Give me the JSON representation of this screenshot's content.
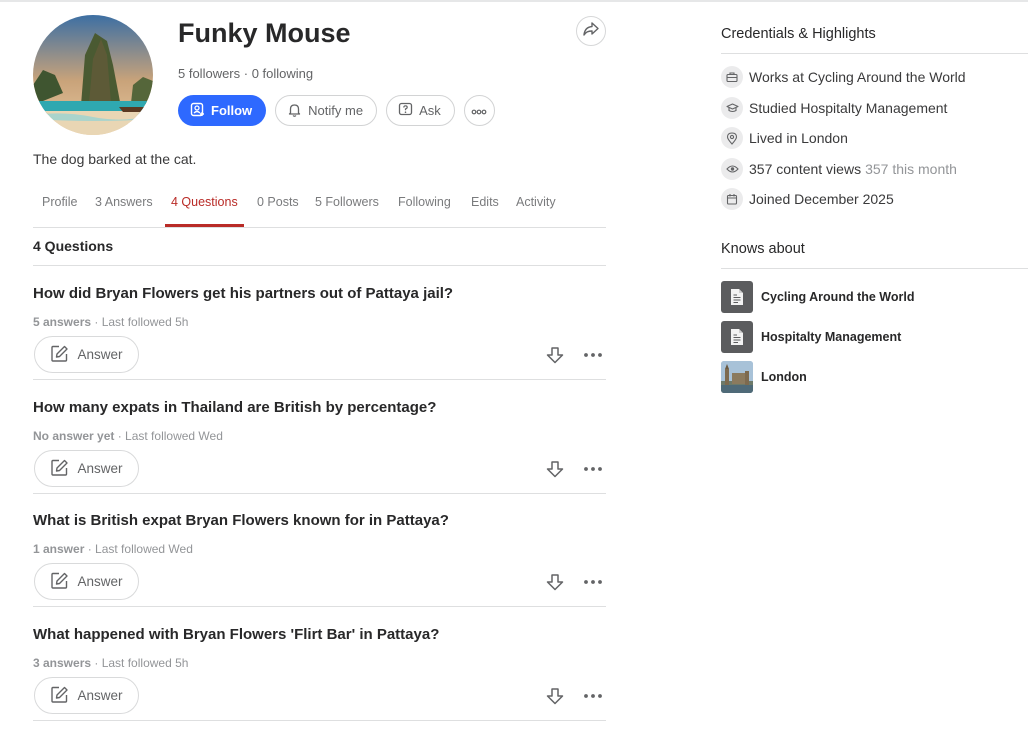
{
  "profile": {
    "name": "Funky Mouse",
    "stats": "5 followers · 0 following",
    "bio": "The dog barked at the cat.",
    "avatar_icon": "beach-cliff-photo"
  },
  "actions": {
    "follow_label": "Follow",
    "notify_label": "Notify me",
    "ask_label": "Ask",
    "accent_color": "#2e69ff"
  },
  "tabs": [
    {
      "label": "Profile",
      "active": false
    },
    {
      "label": "3 Answers",
      "active": false
    },
    {
      "label": "4 Questions",
      "active": true
    },
    {
      "label": "0 Posts",
      "active": false
    },
    {
      "label": "5 Followers",
      "active": false
    },
    {
      "label": "Following",
      "active": false
    },
    {
      "label": "Edits",
      "active": false
    },
    {
      "label": "Activity",
      "active": false
    }
  ],
  "active_tab_color": "#b92b27",
  "questions_section": {
    "title": "4 Questions",
    "answer_label": "Answer",
    "items": [
      {
        "title": "How did Bryan Flowers get his partners out of Pattaya jail?",
        "answers": "5 answers",
        "followed": " · Last followed 5h"
      },
      {
        "title": "How many expats in Thailand are British by percentage?",
        "answers": "No answer yet",
        "followed": " · Last followed Wed"
      },
      {
        "title": "What is British expat Bryan Flowers known for in Pattaya?",
        "answers": "1 answer",
        "followed": " · Last followed Wed"
      },
      {
        "title": "What happened with Bryan Flowers 'Flirt Bar' in Pattaya?",
        "answers": "3 answers",
        "followed": " · Last followed 5h"
      }
    ]
  },
  "sidebar": {
    "credentials_title": "Credentials & Highlights",
    "credentials": [
      {
        "icon": "briefcase-icon",
        "text": "Works at Cycling Around the World",
        "sub": ""
      },
      {
        "icon": "graduation-cap-icon",
        "text": "Studied Hospitalty Management",
        "sub": ""
      },
      {
        "icon": "location-pin-icon",
        "text": "Lived in London",
        "sub": ""
      },
      {
        "icon": "eye-icon",
        "text": "357 content views",
        "sub": "357 this month"
      },
      {
        "icon": "calendar-icon",
        "text": "Joined December 2025",
        "sub": ""
      }
    ],
    "knows_title": "Knows about",
    "topics": [
      {
        "icon": "document-icon",
        "name": "Cycling Around the World"
      },
      {
        "icon": "document-icon",
        "name": "Hospitalty Management"
      },
      {
        "icon": "london-photo",
        "name": "London"
      }
    ]
  }
}
